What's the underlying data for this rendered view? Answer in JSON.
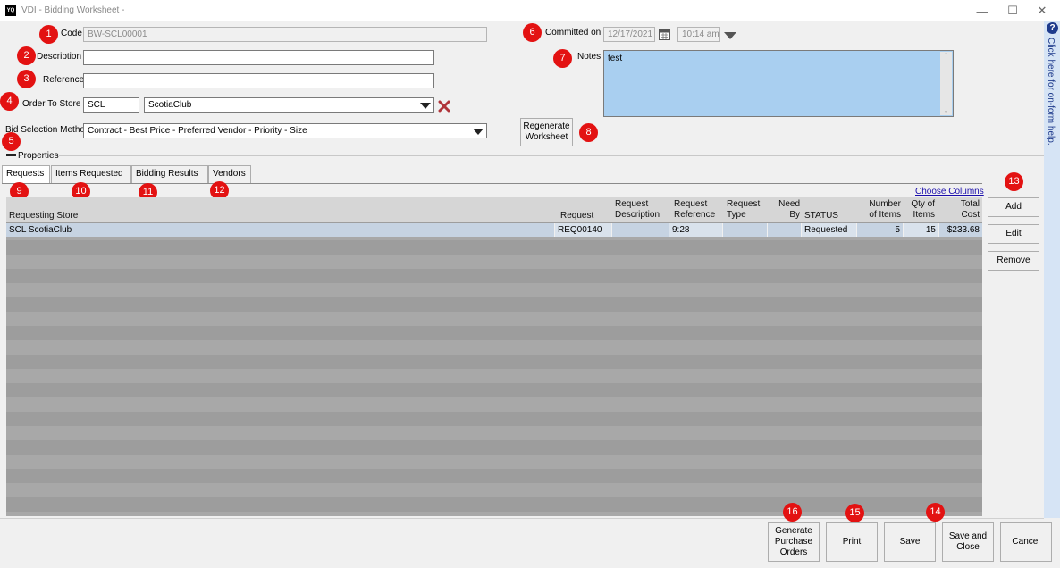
{
  "window": {
    "logo": "YQ",
    "title": "VDI - Bidding Worksheet -"
  },
  "help": {
    "text": "Click here for on-form help."
  },
  "form": {
    "code": {
      "label": "Code",
      "value": "BW-SCL00001"
    },
    "description": {
      "label": "Description",
      "value": ""
    },
    "reference": {
      "label": "Reference",
      "value": ""
    },
    "order_to_store": {
      "label": "Order To Store",
      "code": "SCL",
      "name": "ScotiaClub"
    },
    "bid_selection": {
      "label": "Bid Selection Method",
      "value": "Contract - Best Price - Preferred Vendor - Priority - Size"
    },
    "properties_label": "Properties",
    "committed": {
      "label": "Committed on",
      "date": "12/17/2021",
      "time": "10:14 am"
    },
    "notes": {
      "label": "Notes",
      "value": "test"
    },
    "regenerate_label": "Regenerate Worksheet"
  },
  "tabs": [
    "Requests",
    "Items Requested",
    "Bidding Results",
    "Vendors"
  ],
  "choose_columns": "Choose Columns",
  "grid": {
    "columns": {
      "store": "Requesting Store",
      "request": "Request",
      "desc": "Request Description",
      "ref": "Request Reference",
      "type": "Request Type",
      "need": "Need By",
      "status": "STATUS",
      "items": "Number of Items",
      "qty": "Qty of Items",
      "cost": "Total Cost"
    },
    "rows": [
      {
        "store": "SCL ScotiaClub",
        "request": "REQ00140",
        "desc": "",
        "ref": "9:28",
        "type": "",
        "need": "",
        "status": "Requested",
        "items": "5",
        "qty": "15",
        "cost": "$233.68"
      }
    ]
  },
  "side_buttons": {
    "add": "Add",
    "edit": "Edit",
    "remove": "Remove"
  },
  "footer": {
    "generate": "Generate Purchase Orders",
    "print": "Print",
    "save": "Save",
    "save_close": "Save and Close",
    "cancel": "Cancel"
  },
  "badges": [
    "1",
    "2",
    "3",
    "4",
    "5",
    "6",
    "7",
    "8",
    "9",
    "10",
    "11",
    "12",
    "13",
    "14",
    "15",
    "16"
  ],
  "colors": {
    "badge": "#e31212",
    "notes_bg": "#a9cff0",
    "row_selected": "#c6d3e2",
    "clear_x": "#b0353a"
  }
}
